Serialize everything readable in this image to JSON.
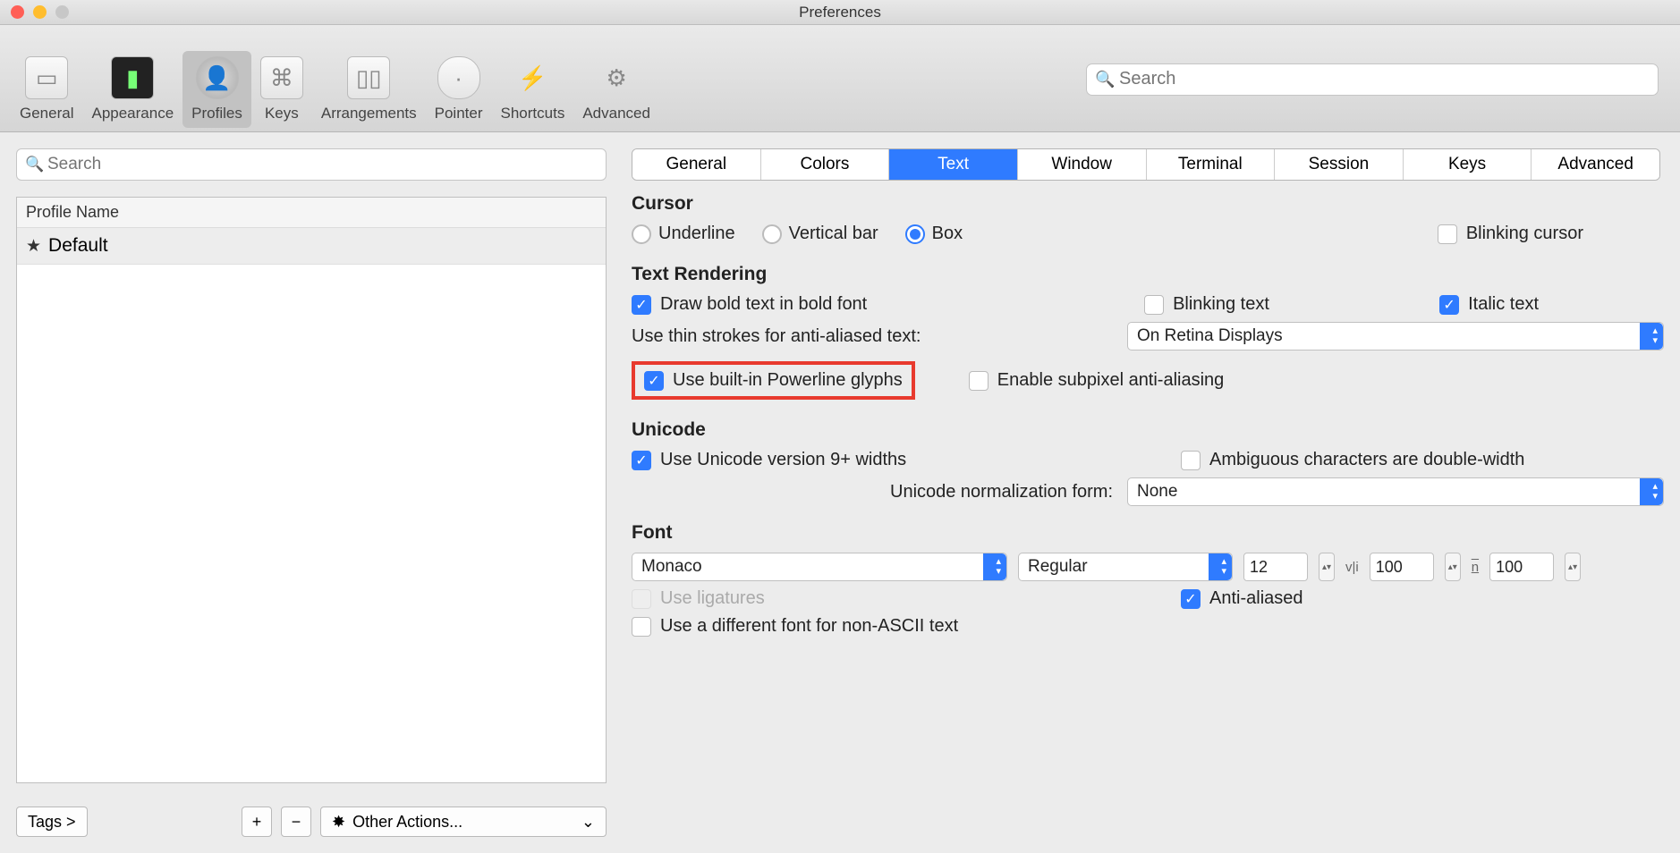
{
  "window": {
    "title": "Preferences"
  },
  "toolbar": {
    "items": [
      "General",
      "Appearance",
      "Profiles",
      "Keys",
      "Arrangements",
      "Pointer",
      "Shortcuts",
      "Advanced"
    ],
    "selected": "Profiles",
    "search_placeholder": "Search"
  },
  "sidebar": {
    "search_placeholder": "Search",
    "header": "Profile Name",
    "items": [
      {
        "name": "Default",
        "starred": true
      }
    ],
    "tags_button": "Tags >",
    "other_actions": "Other Actions..."
  },
  "subtabs": [
    "General",
    "Colors",
    "Text",
    "Window",
    "Terminal",
    "Session",
    "Keys",
    "Advanced"
  ],
  "subtab_active": "Text",
  "sections": {
    "cursor": {
      "title": "Cursor",
      "underline": "Underline",
      "vertical": "Vertical bar",
      "box": "Box",
      "blinking": "Blinking cursor"
    },
    "text_rendering": {
      "title": "Text Rendering",
      "draw_bold": "Draw bold text in bold font",
      "blinking_text": "Blinking text",
      "italic_text": "Italic text",
      "thin_strokes_label": "Use thin strokes for anti-aliased text:",
      "thin_strokes_value": "On Retina Displays",
      "powerline": "Use built-in Powerline glyphs",
      "subpixel": "Enable subpixel anti-aliasing"
    },
    "unicode": {
      "title": "Unicode",
      "v9": "Use Unicode version 9+ widths",
      "ambiguous": "Ambiguous characters are double-width",
      "norm_label": "Unicode normalization form:",
      "norm_value": "None"
    },
    "font": {
      "title": "Font",
      "family": "Monaco",
      "weight": "Regular",
      "size": "12",
      "hspace": "100",
      "vspace": "100",
      "ligatures": "Use ligatures",
      "antialiased": "Anti-aliased",
      "nonascii": "Use a different font for non-ASCII text"
    }
  }
}
